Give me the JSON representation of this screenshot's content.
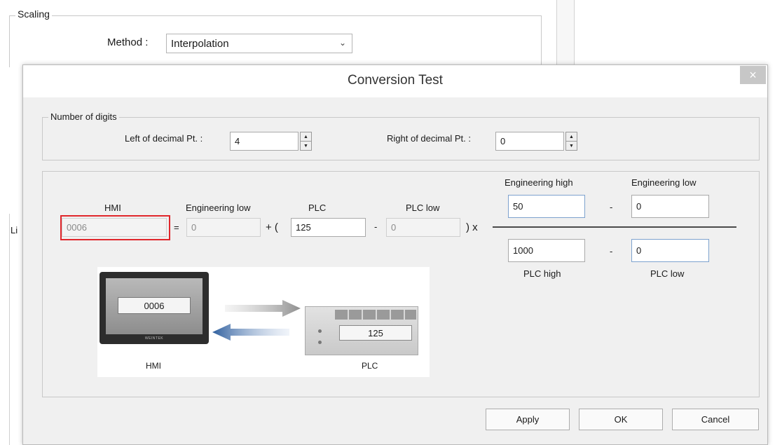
{
  "background": {
    "scaling_legend": "Scaling",
    "method_label": "Method :",
    "method_value": "Interpolation",
    "li_partial": "Li"
  },
  "dialog": {
    "title": "Conversion Test",
    "close_glyph": "×",
    "digits": {
      "legend": "Number of digits",
      "left_label": "Left of decimal Pt. :",
      "left_value": "4",
      "right_label": "Right of decimal Pt. :",
      "right_value": "0"
    },
    "formula": {
      "hmi_label": "HMI",
      "hmi_value": "0006",
      "equals": "=",
      "eng_low_label": "Engineering low",
      "eng_low_value": "0",
      "plus_paren": "+ (",
      "plc_label": "PLC",
      "plc_value": "125",
      "minus1": "-",
      "plc_low_label": "PLC low",
      "plc_low_value": "0",
      "close_paren_x": ") x",
      "eng_high_top_label": "Engineering high",
      "eng_high_top_value": "50",
      "minus2": "-",
      "eng_low_top_label": "Engineering low",
      "eng_low_top_value": "0",
      "plc_high_bottom_value": "1000",
      "minus3": "-",
      "plc_low_bottom_value": "0",
      "plc_high_bottom_label": "PLC high",
      "plc_low_bottom_label": "PLC low"
    },
    "illustration": {
      "hmi_screen_value": "0006",
      "plc_screen_value": "125",
      "hmi_caption": "HMI",
      "plc_caption": "PLC",
      "brand": "WEINTEK"
    },
    "buttons": {
      "apply": "Apply",
      "ok": "OK",
      "cancel": "Cancel"
    }
  },
  "colors": {
    "highlight": "#e0262b",
    "close_button": "#c7c7c7",
    "focus_border": "#7da2ce"
  }
}
